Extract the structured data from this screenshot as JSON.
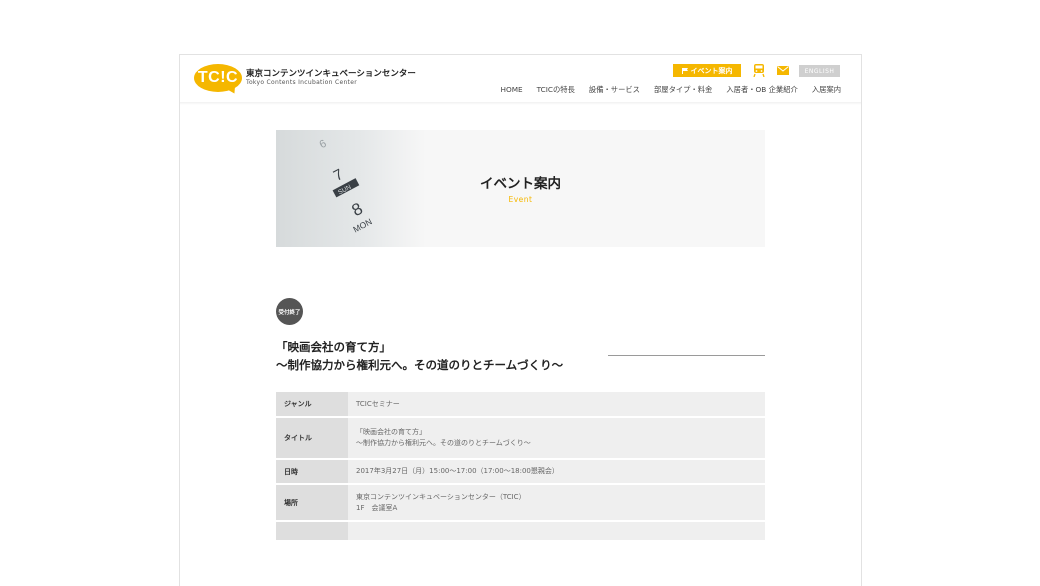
{
  "header": {
    "logo_text": "TC!C",
    "site_name_jp": "東京コンテンツインキュベーションセンター",
    "site_name_en": "Tokyo Contents Incubation Center",
    "event_button": "イベント案内",
    "english_button": "ENGLISH",
    "nav": [
      "HOME",
      "TCICの特長",
      "設備・サービス",
      "部屋タイプ・料金",
      "入居者・OB 企業紹介",
      "入居案内"
    ]
  },
  "hero": {
    "title": "イベント案内",
    "subtitle": "Event"
  },
  "event": {
    "status": "受付終了",
    "title_line1": "「映画会社の育て方」",
    "title_line2": "〜制作協力から権利元へ。その道のりとチームづくり〜"
  },
  "table": {
    "rows": [
      {
        "label": "ジャンル",
        "line1": "TCICセミナー",
        "line2": ""
      },
      {
        "label": "タイトル",
        "line1": "「映画会社の育て方」",
        "line2": "〜制作協力から権利元へ。その道のりとチームづくり〜"
      },
      {
        "label": "日時",
        "line1": "2017年3月27日（月）15:00〜17:00（17:00〜18:00懇親会）",
        "line2": ""
      },
      {
        "label": "場所",
        "line1": "東京コンテンツインキュベーションセンター（TCIC）",
        "line2": "1F　会議室A"
      },
      {
        "label": "",
        "line1": "",
        "line2": ""
      }
    ]
  },
  "colors": {
    "accent": "#f5b700",
    "badge": "#555555"
  }
}
